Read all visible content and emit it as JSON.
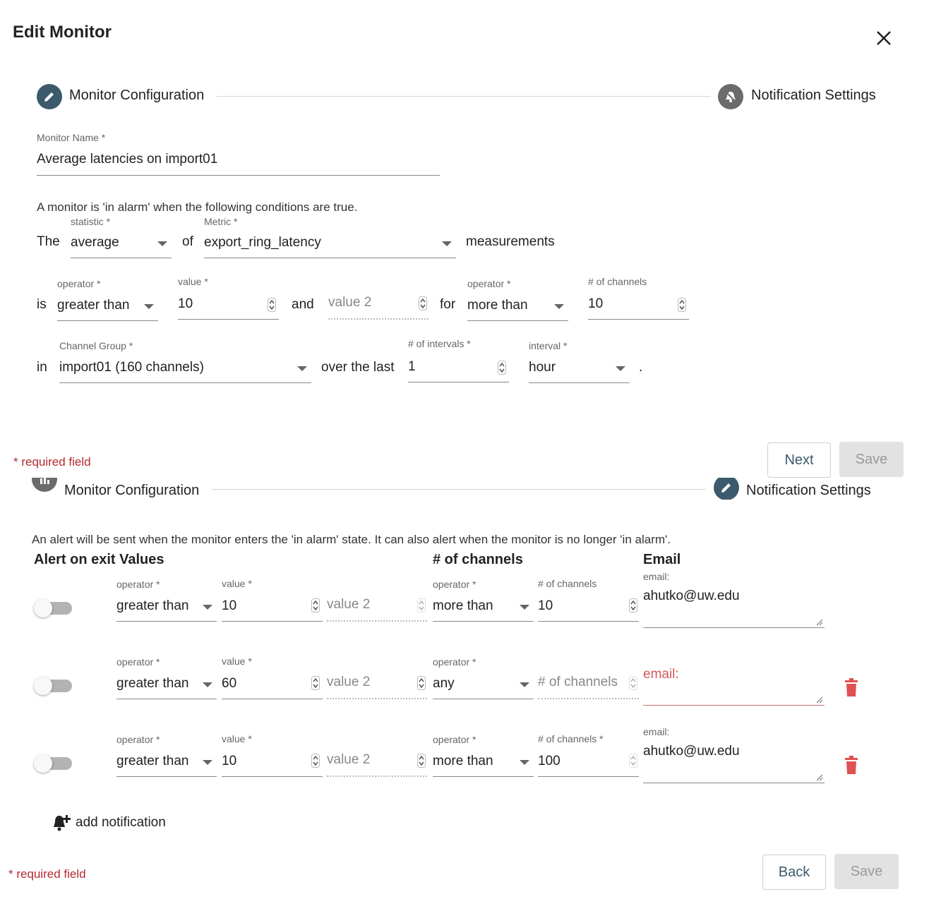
{
  "dialog": {
    "title": "Edit Monitor",
    "close_icon": "close-icon"
  },
  "stepper": {
    "step1": "Monitor Configuration",
    "step2": "Notification Settings"
  },
  "monitor_name": {
    "label": "Monitor Name *",
    "value": "Average latencies on import01"
  },
  "conditions": {
    "intro": "A monitor is 'in alarm' when the following conditions are true.",
    "the": "The",
    "of": "of",
    "measurements": "measurements",
    "statistic_label": "statistic *",
    "statistic_value": "average",
    "metric_label": "Metric *",
    "metric_value": "export_ring_latency",
    "is": "is",
    "and": "and",
    "for": "for",
    "operator_label": "operator *",
    "operator_value": "greater than",
    "value_label": "value *",
    "value_value": "10",
    "value2_placeholder": "value 2",
    "ch_operator_label": "operator *",
    "ch_operator_value": "more than",
    "channels_label": "# of channels",
    "channels_value": "10",
    "in": "in",
    "over_the_last": "over the last",
    "period": ".",
    "group_label": "Channel Group *",
    "group_value": "import01 (160 channels)",
    "intervals_label": "# of intervals *",
    "intervals_value": "1",
    "interval_label": "interval *",
    "interval_value": "hour"
  },
  "footer1": {
    "required": "* required field",
    "next": "Next",
    "save": "Save"
  },
  "notifications": {
    "description": "An alert will be sent when the monitor enters the 'in alarm' state. It can also alert when the monitor is no longer 'in alarm'.",
    "headers": {
      "alert_exit": "Alert on exit Values",
      "channels": "# of channels",
      "email": "Email"
    },
    "rows": [
      {
        "operator_label": "operator *",
        "operator": "greater than",
        "value_label": "value *",
        "value": "10",
        "value2": "value 2",
        "ch_operator_label": "operator *",
        "ch_operator": "more than",
        "channels_label": "# of channels",
        "channels": "10",
        "email_label": "email:",
        "email": "ahutko@uw.edu"
      },
      {
        "operator_label": "operator *",
        "operator": "greater than",
        "value_label": "value *",
        "value": "60",
        "value2": "value 2",
        "ch_operator_label": "operator *",
        "ch_operator": "any",
        "channels_placeholder": "# of channels",
        "email_placeholder": "email:"
      },
      {
        "operator_label": "operator *",
        "operator": "greater than",
        "value_label": "value *",
        "value": "10",
        "value2": "value 2",
        "ch_operator_label": "operator *",
        "ch_operator": "more than",
        "channels_label": "# of channels *",
        "channels": "100",
        "email_label": "email:",
        "email": "ahutko@uw.edu"
      }
    ],
    "add_label": "add notification"
  },
  "footer2": {
    "required": "* required field",
    "back": "Back",
    "save": "Save"
  },
  "colors": {
    "primary": "#3b5a6c",
    "error": "#b5292f",
    "delete": "#e05252"
  }
}
